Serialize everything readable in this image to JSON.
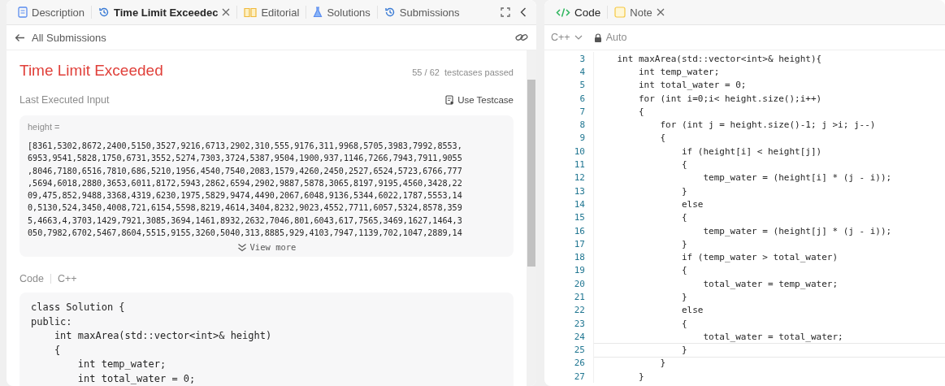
{
  "left_tabs": [
    {
      "label": "Description",
      "kind": "doc",
      "selected": false,
      "closable": false
    },
    {
      "label": "Time Limit Exceedec",
      "kind": "history",
      "selected": true,
      "closable": true
    },
    {
      "label": "Editorial",
      "kind": "book",
      "selected": false,
      "closable": false
    },
    {
      "label": "Solutions",
      "kind": "flask",
      "selected": false,
      "closable": false
    },
    {
      "label": "Submissions",
      "kind": "history",
      "selected": false,
      "closable": false
    }
  ],
  "back_link": "All Submissions",
  "result": {
    "status": "Time Limit Exceeded",
    "passed": "55 / 62",
    "passed_label": "testcases passed"
  },
  "input_section": {
    "title": "Last Executed Input",
    "action": "Use Testcase",
    "variable": "height =",
    "value_lines": [
      "[8361,5302,8672,2400,5150,3527,9216,6713,2902,310,555,9176,311,9968,5705,3983,7992,8553,",
      "6953,9541,5828,1750,6731,3552,5274,7303,3724,5387,9504,1900,937,1146,7266,7943,7911,9055",
      ",8046,7180,6516,7810,686,5210,1956,4540,7540,2083,1579,4260,2450,2527,6524,5723,6766,777",
      ",5694,6018,2880,3653,6011,8172,5943,2862,6594,2902,9887,5878,3065,8197,9195,4560,3428,22",
      "09,475,852,9488,3368,4319,6230,1975,5829,9474,4490,2067,6048,9136,5344,6022,1787,5553,14",
      "0,5130,524,3450,4008,721,6154,5598,8219,4614,3404,8232,9023,4552,7711,6057,5324,8578,359",
      "5,4663,4,3703,1429,7921,3085,3694,1461,8932,2632,7046,801,6043,617,7565,3469,1627,1464,3",
      "050,7982,6702,5467,8604,5515,9155,3260,5040,313,8885,929,4103,7947,1139,702,1047,2889,14"
    ],
    "view_more": "View more"
  },
  "code_section": {
    "title": "Code",
    "language": "C++",
    "lines": [
      "class Solution {",
      "public:",
      "    int maxArea(std::vector<int>& height)",
      "    {",
      "        int temp_water;",
      "        int total_water = 0;"
    ]
  },
  "right_tabs": [
    {
      "label": "Code",
      "kind": "code",
      "selected": true,
      "closable": false
    },
    {
      "label": "Note",
      "kind": "note",
      "selected": false,
      "closable": true
    }
  ],
  "editor": {
    "language": "C++",
    "mode": "Auto",
    "lines": [
      {
        "number": "3",
        "text": "    int maxArea(std::vector<int>& height){",
        "current": false
      },
      {
        "number": "4",
        "text": "        int temp_water;",
        "current": false
      },
      {
        "number": "5",
        "text": "        int total_water = 0;",
        "current": false
      },
      {
        "number": "6",
        "text": "        for (int i=0;i< height.size();i++)",
        "current": false
      },
      {
        "number": "7",
        "text": "        {",
        "current": false
      },
      {
        "number": "8",
        "text": "            for (int j = height.size()-1; j >i; j--)",
        "current": false
      },
      {
        "number": "9",
        "text": "            {",
        "current": false
      },
      {
        "number": "10",
        "text": "                if (height[i] < height[j])",
        "current": false
      },
      {
        "number": "11",
        "text": "                {",
        "current": false
      },
      {
        "number": "12",
        "text": "                    temp_water = (height[i] * (j - i));",
        "current": false
      },
      {
        "number": "13",
        "text": "                }",
        "current": false
      },
      {
        "number": "14",
        "text": "                else",
        "current": false
      },
      {
        "number": "15",
        "text": "                {",
        "current": false
      },
      {
        "number": "16",
        "text": "                    temp_water = (height[j] * (j - i));",
        "current": false
      },
      {
        "number": "17",
        "text": "                }",
        "current": false
      },
      {
        "number": "18",
        "text": "                if (temp_water > total_water)",
        "current": false
      },
      {
        "number": "19",
        "text": "                {",
        "current": false
      },
      {
        "number": "20",
        "text": "                    total_water = temp_water;",
        "current": false
      },
      {
        "number": "21",
        "text": "                }",
        "current": false
      },
      {
        "number": "22",
        "text": "                else",
        "current": false
      },
      {
        "number": "23",
        "text": "                {",
        "current": false
      },
      {
        "number": "24",
        "text": "                    total_water = total_water;",
        "current": false
      },
      {
        "number": "25",
        "text": "                }",
        "current": true
      },
      {
        "number": "26",
        "text": "            }",
        "current": false
      },
      {
        "number": "27",
        "text": "        }",
        "current": false
      }
    ]
  }
}
